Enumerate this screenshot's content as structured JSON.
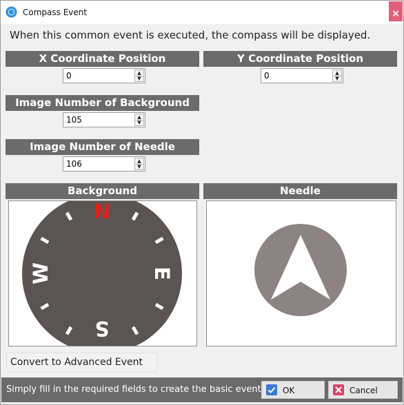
{
  "window": {
    "title": "Compass Event",
    "close_glyph": "×",
    "icon": "compass-app-icon"
  },
  "intro_text": "When this common event is executed, the compass will be displayed.",
  "fields": {
    "x_coordinate": {
      "label": "X Coordinate Position",
      "value": "0"
    },
    "y_coordinate": {
      "label": "Y Coordinate Position",
      "value": "0"
    },
    "background_image": {
      "label": "Image Number of Background",
      "value": "105"
    },
    "needle_image": {
      "label": "Image Number of Needle",
      "value": "106"
    }
  },
  "previews": {
    "background": {
      "label": "Background",
      "letters": {
        "north": "N",
        "east": "E",
        "south": "S",
        "west": "W"
      },
      "dial_color": "#5a5452",
      "north_color": "#e0201f"
    },
    "needle": {
      "label": "Needle",
      "disc_color": "#8b8482"
    }
  },
  "convert_button": "Convert to Advanced Event",
  "footer": {
    "hint": "Simply fill in the required fields to create the basic event",
    "ok_label": "OK",
    "cancel_label": "Cancel",
    "ok_icon": "checkmark-icon",
    "cancel_icon": "x-icon"
  },
  "colors": {
    "header_gray": "#6b6b6b",
    "close_red": "#e0607a",
    "ok_blue": "#3a78d8",
    "cancel_pink": "#d9446a"
  }
}
